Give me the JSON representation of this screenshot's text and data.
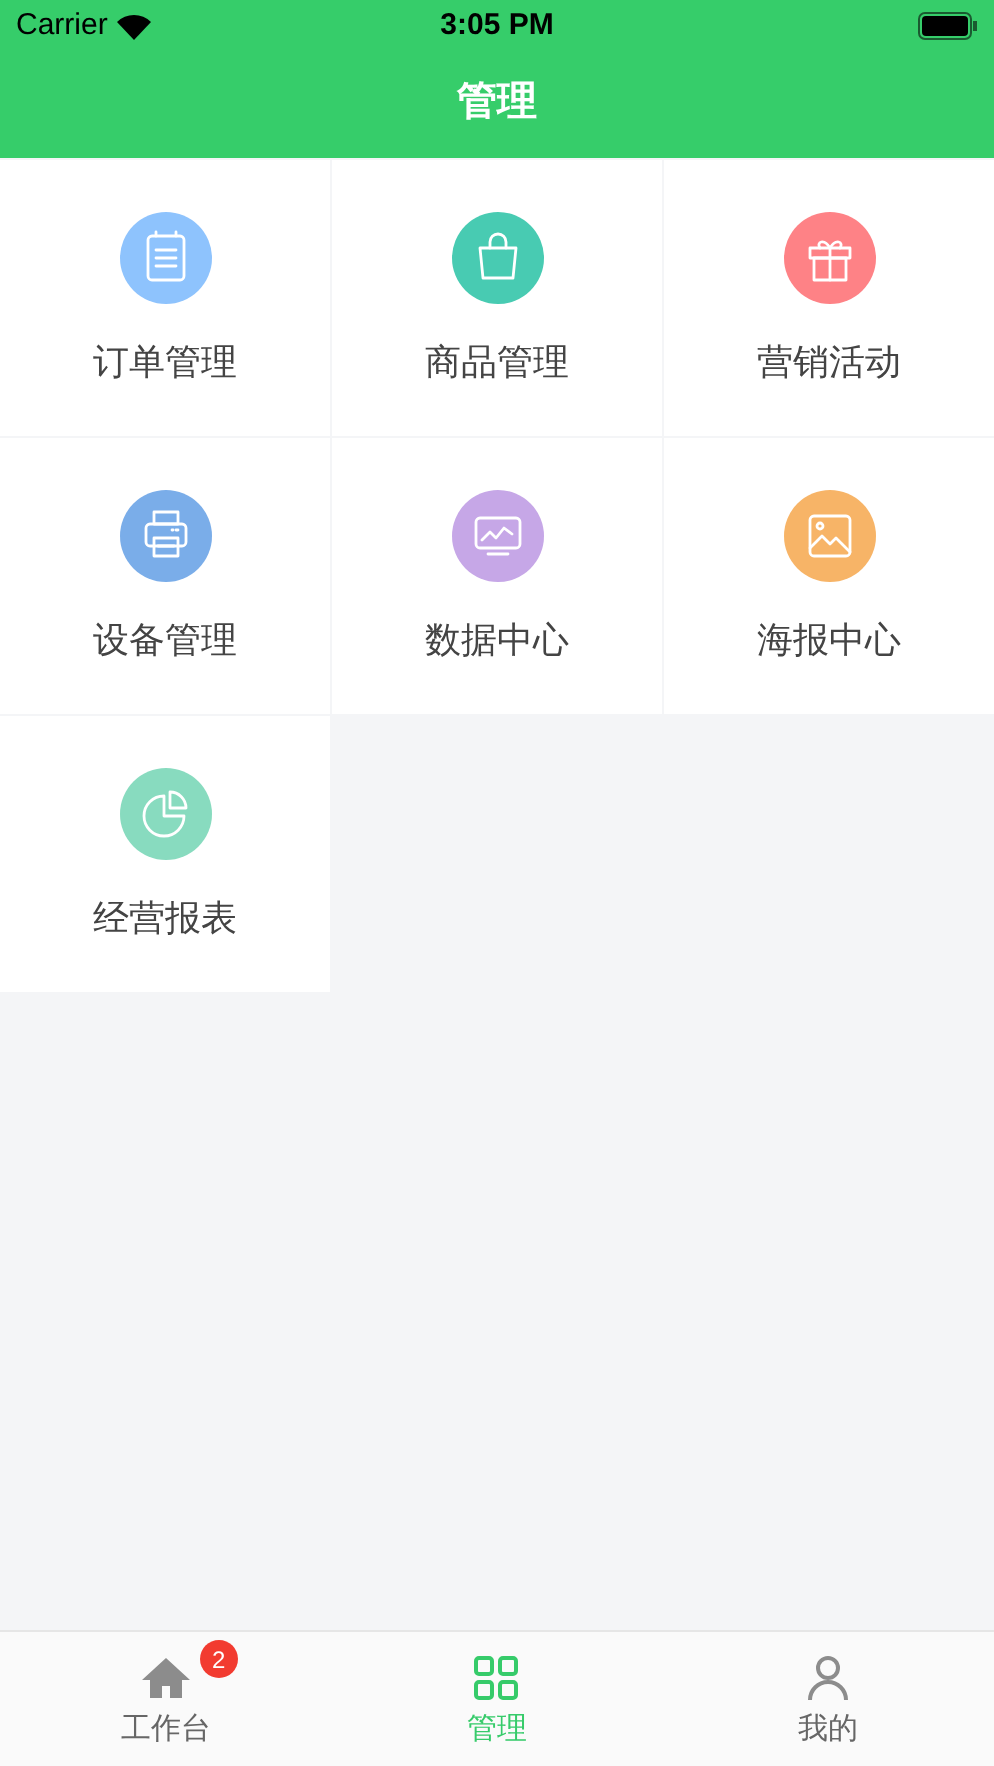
{
  "status_bar": {
    "carrier": "Carrier",
    "time": "3:05 PM"
  },
  "header": {
    "title": "管理"
  },
  "grid": [
    {
      "label": "订单管理",
      "kind": "clipboard",
      "color": "#8ec3fd"
    },
    {
      "label": "商品管理",
      "kind": "bag",
      "color": "#48cbb2"
    },
    {
      "label": "营销活动",
      "kind": "gift",
      "color": "#fe8286"
    },
    {
      "label": "设备管理",
      "kind": "printer",
      "color": "#7aade9"
    },
    {
      "label": "数据中心",
      "kind": "monitor",
      "color": "#c6a7e7"
    },
    {
      "label": "海报中心",
      "kind": "image",
      "color": "#f7b467"
    },
    {
      "label": "经营报表",
      "kind": "pie",
      "color": "#88dbbf"
    }
  ],
  "tab_bar": [
    {
      "label": "工作台",
      "kind": "home",
      "selected": false,
      "badge": "2"
    },
    {
      "label": "管理",
      "kind": "grid",
      "selected": true
    },
    {
      "label": "我的",
      "kind": "person",
      "selected": false
    }
  ]
}
